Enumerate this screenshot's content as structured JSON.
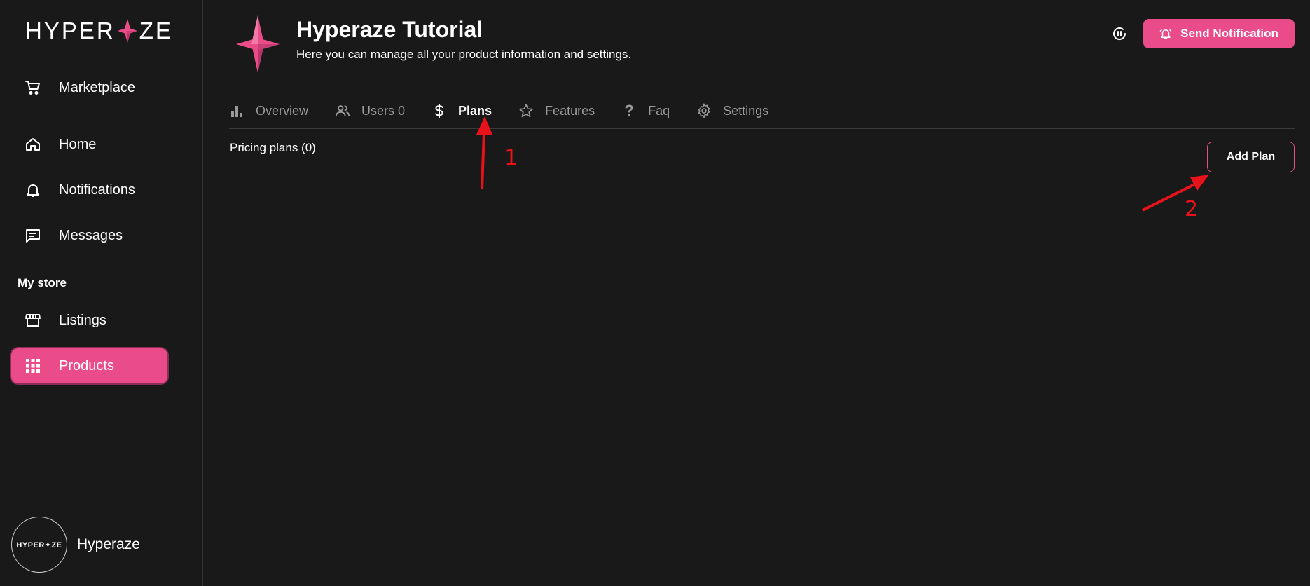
{
  "brand": {
    "logo_text_left": "HYPER",
    "logo_text_right": "ZE",
    "accent_color": "#ea4c89"
  },
  "sidebar": {
    "marketplace": {
      "label": "Marketplace",
      "icon": "cart-icon"
    },
    "items": [
      {
        "label": "Home",
        "icon": "home-icon"
      },
      {
        "label": "Notifications",
        "icon": "bell-icon"
      },
      {
        "label": "Messages",
        "icon": "message-icon"
      }
    ],
    "section_label": "My store",
    "store_items": [
      {
        "label": "Listings",
        "icon": "storefront-icon"
      },
      {
        "label": "Products",
        "icon": "grid-icon",
        "active": true
      }
    ],
    "profile": {
      "avatar_text": "HYPER✦ZE",
      "name": "Hyperaze"
    }
  },
  "header": {
    "title": "Hyperaze Tutorial",
    "subtitle": "Here you can manage all your product information and settings.",
    "send_notification_label": "Send Notification"
  },
  "tabs": [
    {
      "label": "Overview",
      "icon": "bar-chart-icon"
    },
    {
      "label": "Users 0",
      "icon": "users-icon"
    },
    {
      "label": "Plans",
      "icon": "dollar-icon",
      "active": true
    },
    {
      "label": "Features",
      "icon": "star-icon"
    },
    {
      "label": "Faq",
      "icon": "question-icon"
    },
    {
      "label": "Settings",
      "icon": "gear-icon"
    }
  ],
  "content": {
    "pricing_label": "Pricing plans (0)",
    "add_plan_label": "Add Plan"
  },
  "annotations": {
    "color": "#e8121a",
    "step1": "1",
    "step2": "2"
  }
}
